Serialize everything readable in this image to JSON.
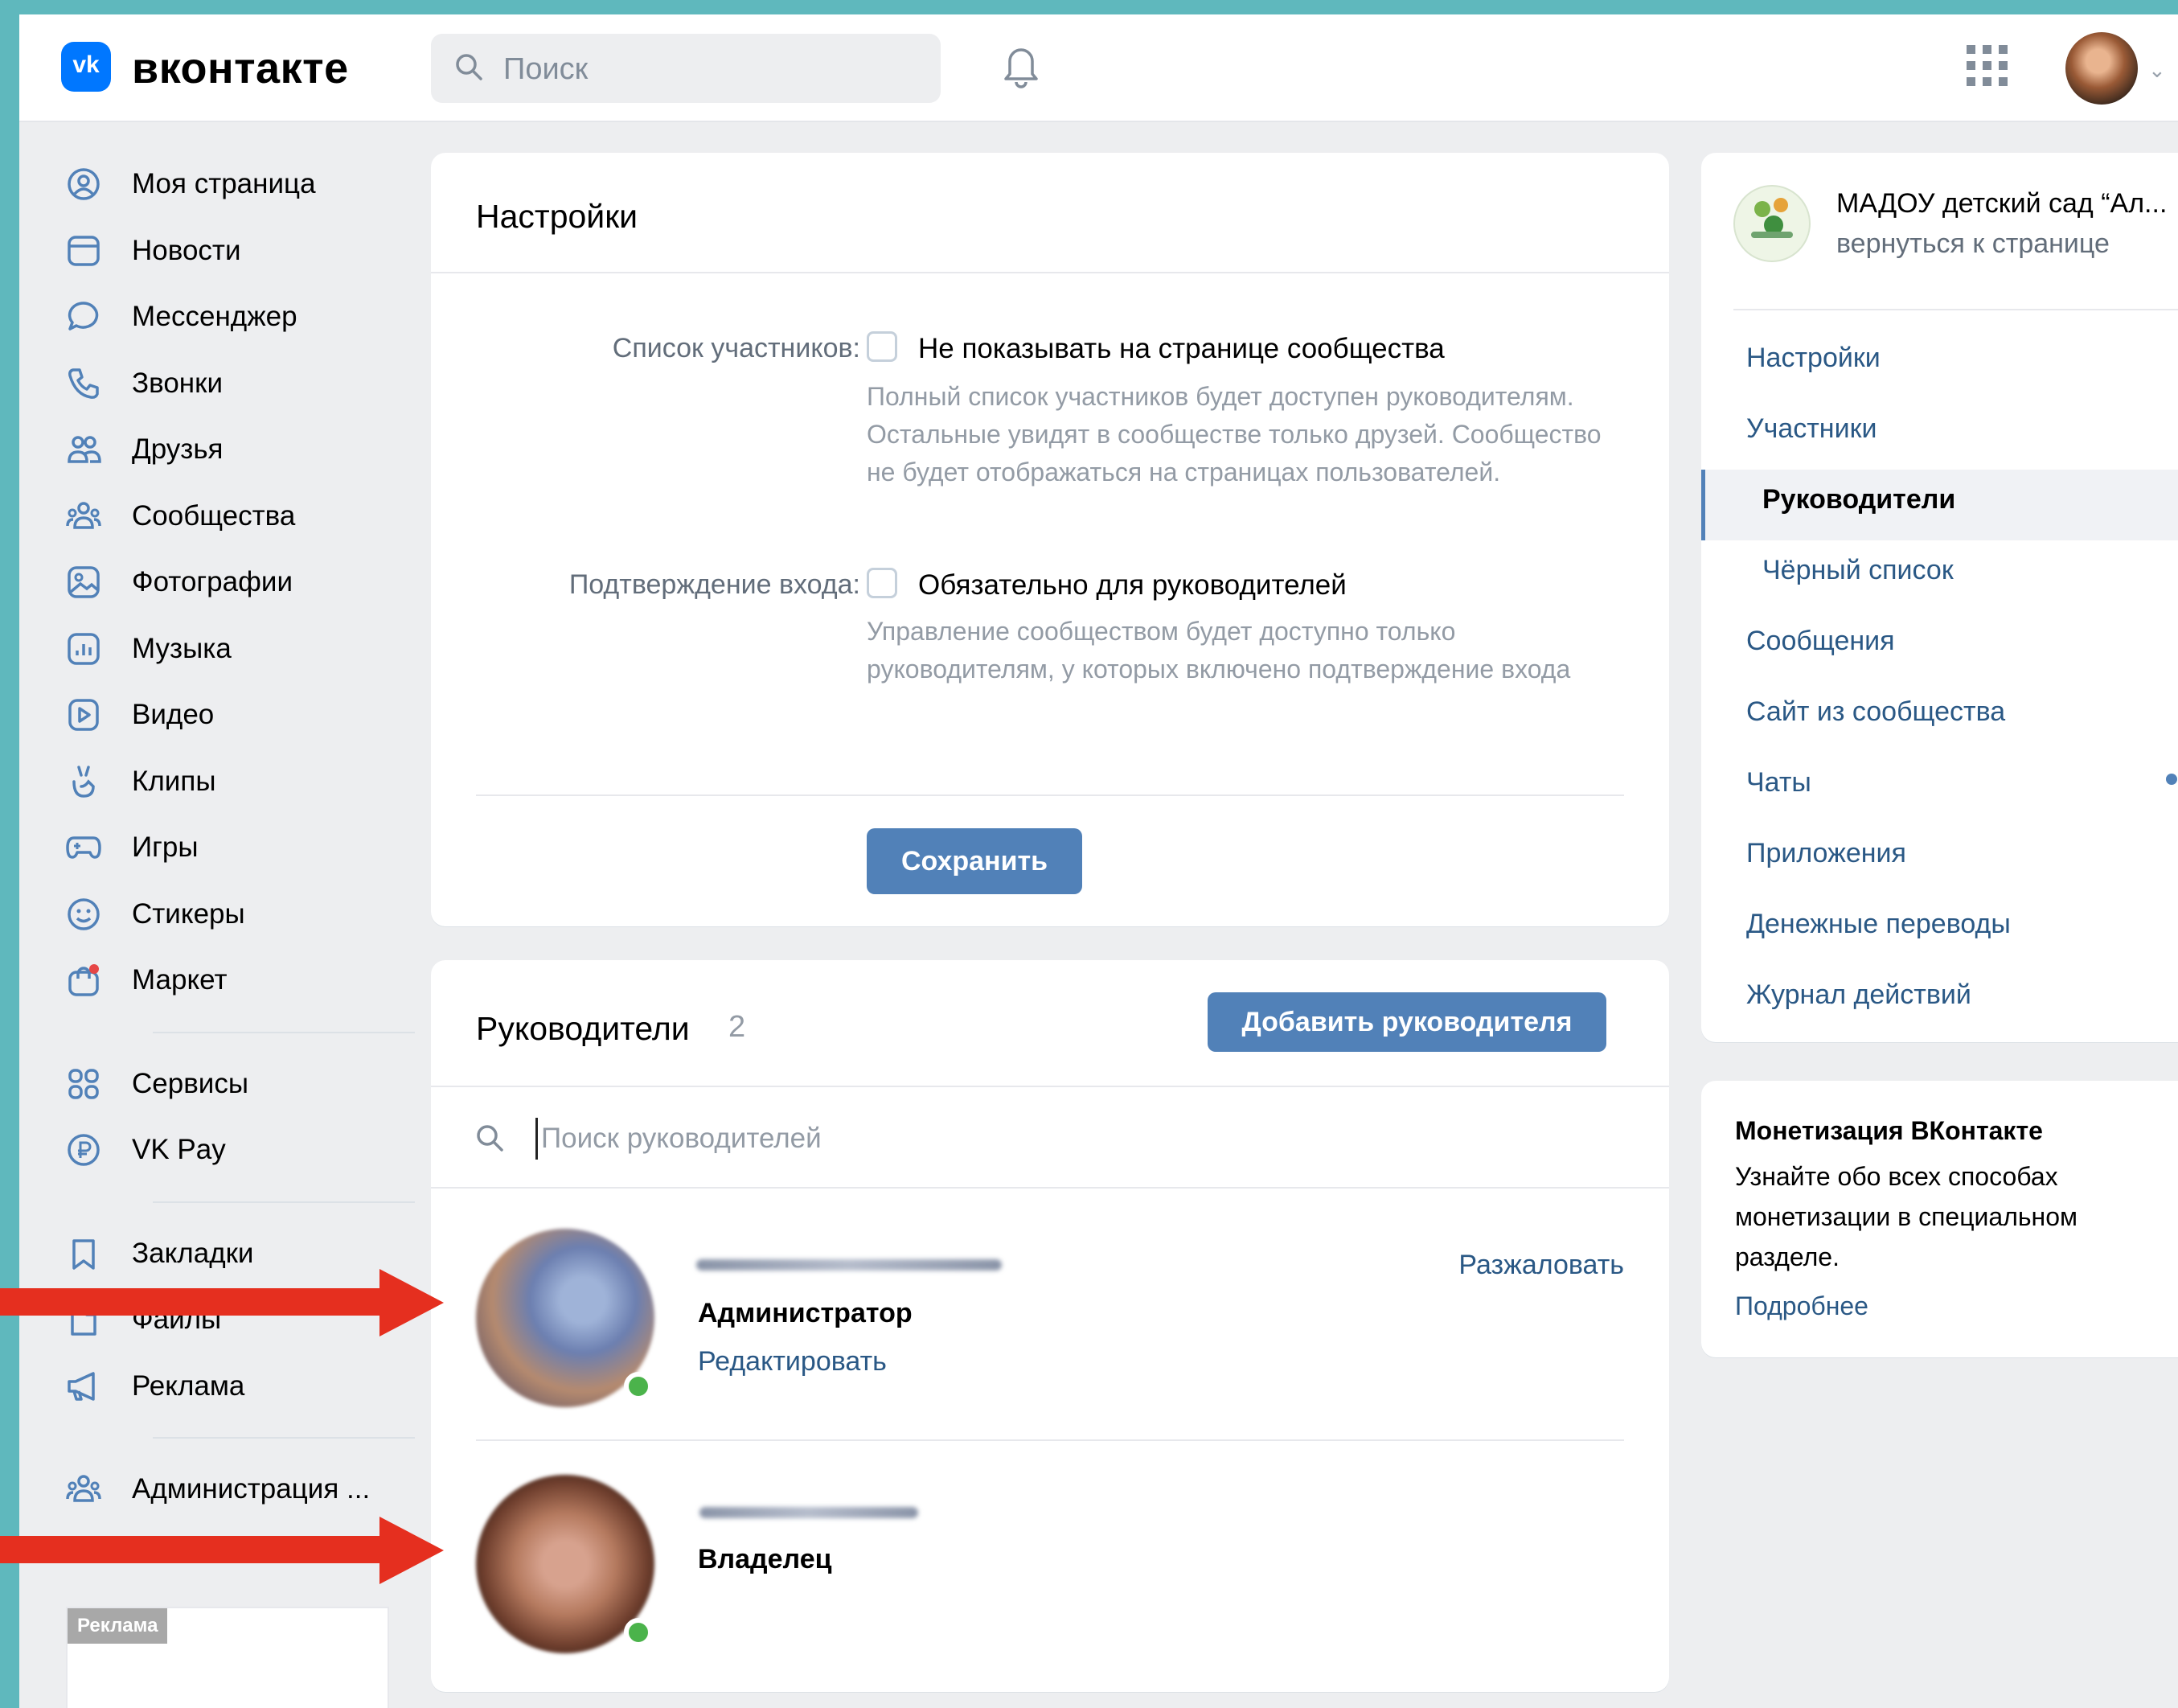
{
  "header": {
    "logo_letter": "vk",
    "logo_text": "вконтакте",
    "search_placeholder": "Поиск"
  },
  "nav": {
    "items": [
      {
        "label": "Моя страница",
        "icon": "user-circle-icon"
      },
      {
        "label": "Новости",
        "icon": "news-icon"
      },
      {
        "label": "Мессенджер",
        "icon": "message-icon"
      },
      {
        "label": "Звонки",
        "icon": "phone-icon"
      },
      {
        "label": "Друзья",
        "icon": "friends-icon"
      },
      {
        "label": "Сообщества",
        "icon": "communities-icon"
      },
      {
        "label": "Фотографии",
        "icon": "photo-icon"
      },
      {
        "label": "Музыка",
        "icon": "music-icon"
      },
      {
        "label": "Видео",
        "icon": "video-icon"
      },
      {
        "label": "Клипы",
        "icon": "clips-icon"
      },
      {
        "label": "Игры",
        "icon": "gamepad-icon"
      },
      {
        "label": "Стикеры",
        "icon": "smile-icon"
      },
      {
        "label": "Маркет",
        "icon": "market-icon"
      }
    ],
    "items2": [
      {
        "label": "Сервисы",
        "icon": "services-icon"
      },
      {
        "label": "VK Pay",
        "icon": "ruble-icon"
      }
    ],
    "items3": [
      {
        "label": "Закладки",
        "icon": "bookmark-icon"
      },
      {
        "label": "Файлы",
        "icon": "file-icon"
      },
      {
        "label": "Реклама",
        "icon": "megaphone-icon"
      }
    ],
    "items4": [
      {
        "label": "Администрация ...",
        "icon": "communities-icon"
      }
    ],
    "ad_tag": "Реклама"
  },
  "settings": {
    "title": "Настройки",
    "members_label": "Список участников:",
    "members_checkbox": "Не показывать на странице сообщества",
    "members_help": "Полный список участников будет доступен руководителям. Остальные увидят в сообществе только друзей. Сообщество не будет отображаться на страницах пользователей.",
    "login_label": "Подтверждение входа:",
    "login_checkbox": "Обязательно для руководителей",
    "login_help": "Управление сообществом будет доступно только руководителям, у которых включено подтверждение входа",
    "save": "Сохранить"
  },
  "managers": {
    "title": "Руководители",
    "count": "2",
    "add_button": "Добавить руководителя",
    "search_placeholder": "Поиск руководителей",
    "list": [
      {
        "role": "Администратор",
        "edit": "Редактировать",
        "action": "Разжаловать"
      },
      {
        "role": "Владелец"
      }
    ]
  },
  "right_menu": {
    "community_name": "МАДОУ детский сад “Ал...",
    "back": "вернуться к странице",
    "items": [
      "Настройки",
      "Участники",
      "Руководители",
      "Чёрный список",
      "Сообщения",
      "Сайт из сообщества",
      "Чаты",
      "Приложения",
      "Денежные переводы",
      "Журнал действий"
    ],
    "active": "Руководители"
  },
  "monetization": {
    "title": "Монетизация ВКонтакте",
    "text": "Узнайте обо всех способах монетизации в специальном разделе.",
    "link": "Подробнее"
  },
  "colors": {
    "accent": "#5181b8",
    "link": "#2a5885",
    "brand": "#0077ff",
    "arrow": "#e52f1f",
    "online": "#4bb34b"
  }
}
